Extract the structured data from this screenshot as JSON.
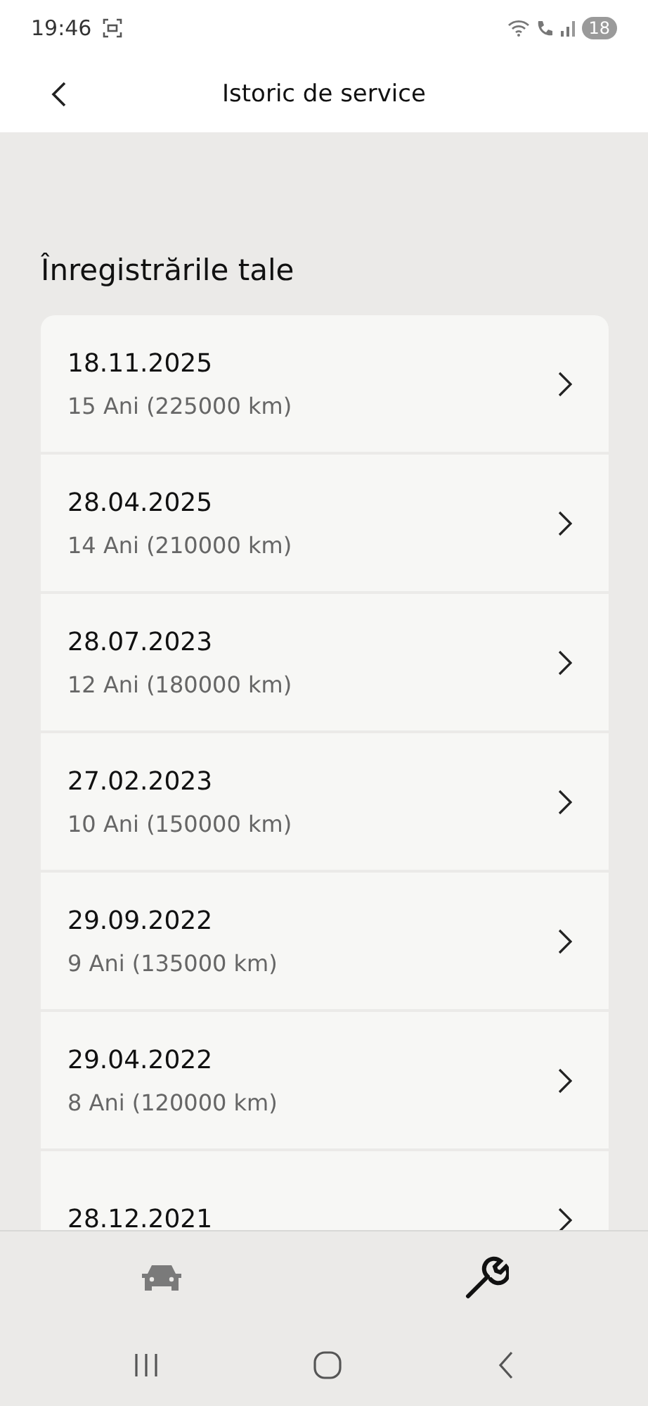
{
  "status_bar": {
    "time": "19:46",
    "battery": "18"
  },
  "header": {
    "title": "Istoric de service"
  },
  "section_title": "Înregistrările tale",
  "records": [
    {
      "date": "18.11.2025",
      "details": "15 Ani (225000 km)"
    },
    {
      "date": "28.04.2025",
      "details": "14 Ani (210000 km)"
    },
    {
      "date": "28.07.2023",
      "details": "12 Ani (180000 km)"
    },
    {
      "date": "27.02.2023",
      "details": "10 Ani (150000 km)"
    },
    {
      "date": "29.09.2022",
      "details": "9 Ani (135000 km)"
    },
    {
      "date": "29.04.2022",
      "details": "8 Ani (120000 km)"
    },
    {
      "date": "28.12.2021"
    }
  ],
  "bottom_tabs": [
    {
      "kind": "car",
      "selected": false
    },
    {
      "kind": "wrench",
      "selected": true
    }
  ]
}
